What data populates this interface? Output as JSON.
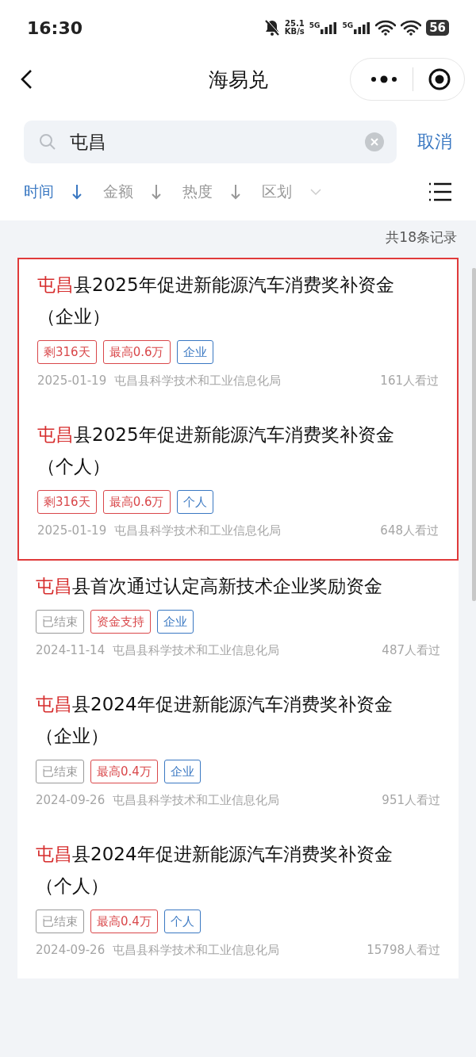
{
  "status_bar": {
    "time": "16:30",
    "speed_value": "25.1",
    "speed_unit": "KB/s",
    "signals": [
      "5G",
      "5G"
    ],
    "battery": "56"
  },
  "nav": {
    "title": "海易兑"
  },
  "search": {
    "value": "屯昌",
    "cancel": "取消"
  },
  "filters": [
    {
      "label": "时间",
      "kind": "sort",
      "selected": true
    },
    {
      "label": "金额",
      "kind": "sort",
      "selected": false
    },
    {
      "label": "热度",
      "kind": "sort",
      "selected": false
    },
    {
      "label": "区划",
      "kind": "dropdown",
      "selected": false
    }
  ],
  "count": "共18条记录",
  "results": [
    {
      "highlight": "屯昌",
      "title": "县2025年促进新能源汽车消费奖补资金（企业）",
      "highlighted": true,
      "tags": [
        {
          "text": "剩316天",
          "color": "#d9474a"
        },
        {
          "text": "最高0.6万",
          "color": "#d9474a"
        },
        {
          "text": "企业",
          "color": "#3a78c2"
        }
      ],
      "date": "2025-01-19",
      "agency": "屯昌县科学技术和工业信息化局",
      "views": "161人看过"
    },
    {
      "highlight": "屯昌",
      "title": "县2025年促进新能源汽车消费奖补资金（个人）",
      "highlighted": true,
      "tags": [
        {
          "text": "剩316天",
          "color": "#d9474a"
        },
        {
          "text": "最高0.6万",
          "color": "#d9474a"
        },
        {
          "text": "个人",
          "color": "#3a78c2"
        }
      ],
      "date": "2025-01-19",
      "agency": "屯昌县科学技术和工业信息化局",
      "views": "648人看过"
    },
    {
      "highlight": "屯昌",
      "title": "县首次通过认定高新技术企业奖励资金",
      "highlighted": false,
      "tags": [
        {
          "text": "已结束",
          "color": "#999999"
        },
        {
          "text": "资金支持",
          "color": "#d9474a"
        },
        {
          "text": "企业",
          "color": "#3a78c2"
        }
      ],
      "date": "2024-11-14",
      "agency": "屯昌县科学技术和工业信息化局",
      "views": "487人看过"
    },
    {
      "highlight": "屯昌",
      "title": "县2024年促进新能源汽车消费奖补资金（企业）",
      "highlighted": false,
      "tags": [
        {
          "text": "已结束",
          "color": "#999999"
        },
        {
          "text": "最高0.4万",
          "color": "#d9474a"
        },
        {
          "text": "企业",
          "color": "#3a78c2"
        }
      ],
      "date": "2024-09-26",
      "agency": "屯昌县科学技术和工业信息化局",
      "views": "951人看过"
    },
    {
      "highlight": "屯昌",
      "title": "县2024年促进新能源汽车消费奖补资金（个人）",
      "highlighted": false,
      "tags": [
        {
          "text": "已结束",
          "color": "#999999"
        },
        {
          "text": "最高0.4万",
          "color": "#d9474a"
        },
        {
          "text": "个人",
          "color": "#3a78c2"
        }
      ],
      "date": "2024-09-26",
      "agency": "屯昌县科学技术和工业信息化局",
      "views": "15798人看过"
    }
  ]
}
